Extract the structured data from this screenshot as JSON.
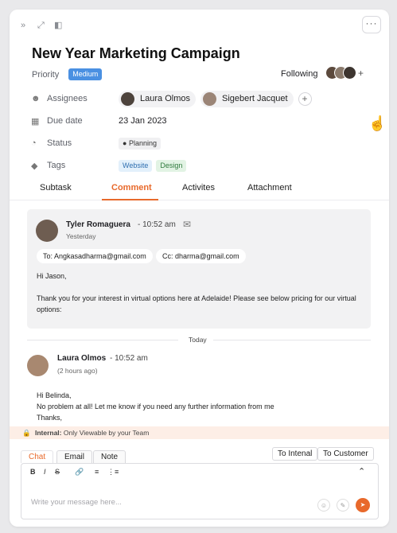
{
  "window": {
    "collapse_icon": "»",
    "expand_icon": "⤢",
    "sidebar_icon": "◧",
    "more_icon": "···"
  },
  "task": {
    "title": "New Year Marketing Campaign",
    "priority_label": "Priority",
    "priority_value": "Medium",
    "following_label": "Following",
    "assignees_label": "Assignees",
    "assignees": [
      "Laura Olmos",
      "Sigebert Jacquet"
    ],
    "due_label": "Due date",
    "due_value": "23 Jan 2023",
    "status_label": "Status",
    "status_value": "Planning",
    "tags_label": "Tags",
    "tags": [
      "Website",
      "Design"
    ]
  },
  "tabs": [
    "Subtask",
    "Comment",
    "Activites",
    "Attachment"
  ],
  "active_tab": "Comment",
  "email": {
    "sender": "Tyler Romaguera",
    "time": "- 10:52 am",
    "date": "Yesterday",
    "to": "To: Angkasadharma@gmail.com",
    "cc": "Cc: dharma@gmail.com",
    "greeting": "Hi Jason,",
    "body_line1": "Thank you for your interest in virtual options here at Adelaide! Please see below pricing for our virtual",
    "body_line2": "options:"
  },
  "divider_label": "Today",
  "comment": {
    "author": "Laura Olmos",
    "time": "- 10:52 am",
    "relative": "(2 hours ago)",
    "line1": "Hi Belinda,",
    "line2": "No problem at all! Let me know if you need any further information from me",
    "line3": "Thanks,"
  },
  "internal_notice": {
    "label": "Internal:",
    "text": "Only Viewable by your Team"
  },
  "composer": {
    "tabs": [
      "Chat",
      "Email",
      "Note"
    ],
    "active_tab": "Chat",
    "to_internal": "To Intenal",
    "to_customer": "To Customer",
    "placeholder": "Write your message here...",
    "format_bold": "B",
    "format_italic": "I",
    "format_strike": "S"
  },
  "colors": {
    "accent": "#e8692b",
    "priority_badge": "#4a90e2",
    "tag_website_bg": "#e3f0fb",
    "tag_design_bg": "#e2f3e4"
  }
}
